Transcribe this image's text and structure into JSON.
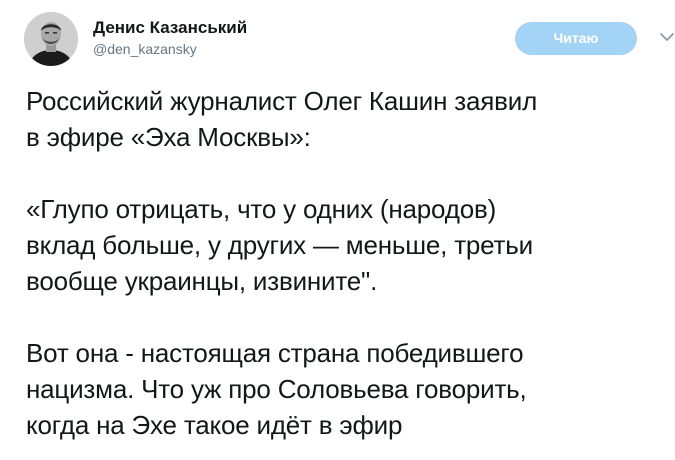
{
  "author": {
    "display_name": "Денис Казанський",
    "screen_name": "@den_kazansky"
  },
  "actions": {
    "follow_label": "Читаю"
  },
  "tweet": {
    "paragraphs": [
      {
        "lines": [
          "Российский журналист Олег Кашин заявил",
          "в эфире «Эха Москвы»:"
        ]
      },
      {
        "lines": [
          "«Глупо отрицать, что у одних (народов)",
          "вклад больше, у других — меньше, третьи",
          "вообще украинцы, извините\"."
        ]
      },
      {
        "lines": [
          "Вот она - настоящая страна победившего",
          "нацизма. Что уж про Соловьева говорить,",
          "когда на Эхе такое идёт в эфир"
        ]
      }
    ]
  },
  "icons": {
    "caret": "chevron-down-icon",
    "avatar": "avatar"
  },
  "colors": {
    "follow_button_bg": "#a3d4f6",
    "follow_button_text": "#ffffff",
    "name_text": "#14171a",
    "secondary_text": "#657786",
    "caret": "#8899a6"
  }
}
